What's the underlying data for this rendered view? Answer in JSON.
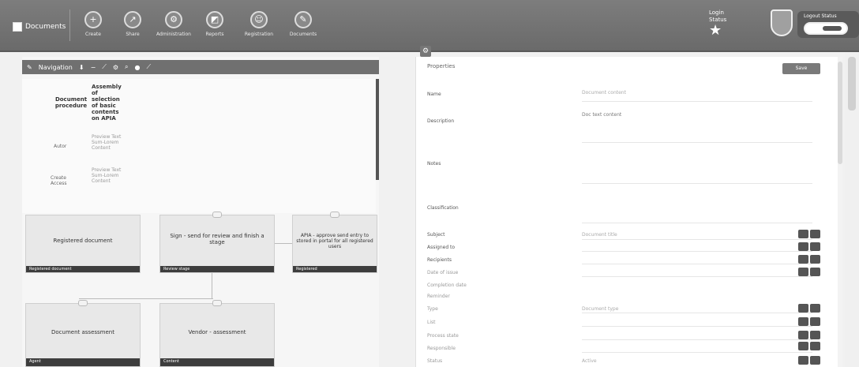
{
  "toolbar": {
    "brand": "Documents",
    "tools": [
      {
        "label": "Create",
        "icon": "plus-icon"
      },
      {
        "label": "Share",
        "icon": "share-icon"
      },
      {
        "label": "Administration",
        "icon": "gear-icon"
      },
      {
        "label": "Reports",
        "icon": "chart-icon"
      },
      {
        "label": "Registration",
        "icon": "user-icon"
      },
      {
        "label": "Documents",
        "icon": "folder-icon"
      }
    ],
    "user_line1": "Login",
    "user_line2": "Status",
    "toggle_label": "Logout Status"
  },
  "left": {
    "toolbar_title": "Navigation",
    "table": {
      "header_left": "Document procedure",
      "header_right": "Assembly of selection of basic contents on APIA",
      "rows": [
        {
          "label": "Autor",
          "value": "Preview Text Sum-Lorem Content"
        },
        {
          "label": "Create Access",
          "value": "Preview Text Sum-Lorem Content"
        }
      ]
    },
    "cards": [
      {
        "title": "Registered document",
        "footer": "Registered document"
      },
      {
        "title": "Sign - send for review and finish a stage",
        "footer": "Review stage"
      },
      {
        "title": "APIA - approve send entry to stored in portal for all registered users",
        "footer": "Registered"
      },
      {
        "title": "Document assessment",
        "footer": "Agent"
      },
      {
        "title": "Vendor - assessment",
        "footer": "Content"
      }
    ]
  },
  "right": {
    "title": "Properties",
    "button": "Save",
    "fields": [
      {
        "label": "Name",
        "value": "Document content"
      },
      {
        "label": "Description",
        "value": "Doc text content"
      },
      {
        "label": "Notes",
        "value": ""
      },
      {
        "label": "Classification",
        "value": ""
      },
      {
        "label": "Subject",
        "value": "Document title"
      },
      {
        "label": "Assigned to",
        "value": ""
      },
      {
        "label": "Recipients",
        "value": ""
      },
      {
        "label": "Date of issue",
        "value": ""
      },
      {
        "label": "Completion date",
        "value": ""
      },
      {
        "label": "Reminder",
        "value": ""
      },
      {
        "label": "Type",
        "value": "Document type"
      },
      {
        "label": "List",
        "value": ""
      },
      {
        "label": "Process state",
        "value": ""
      },
      {
        "label": "Responsible",
        "value": ""
      },
      {
        "label": "Status",
        "value": "Active"
      }
    ]
  }
}
